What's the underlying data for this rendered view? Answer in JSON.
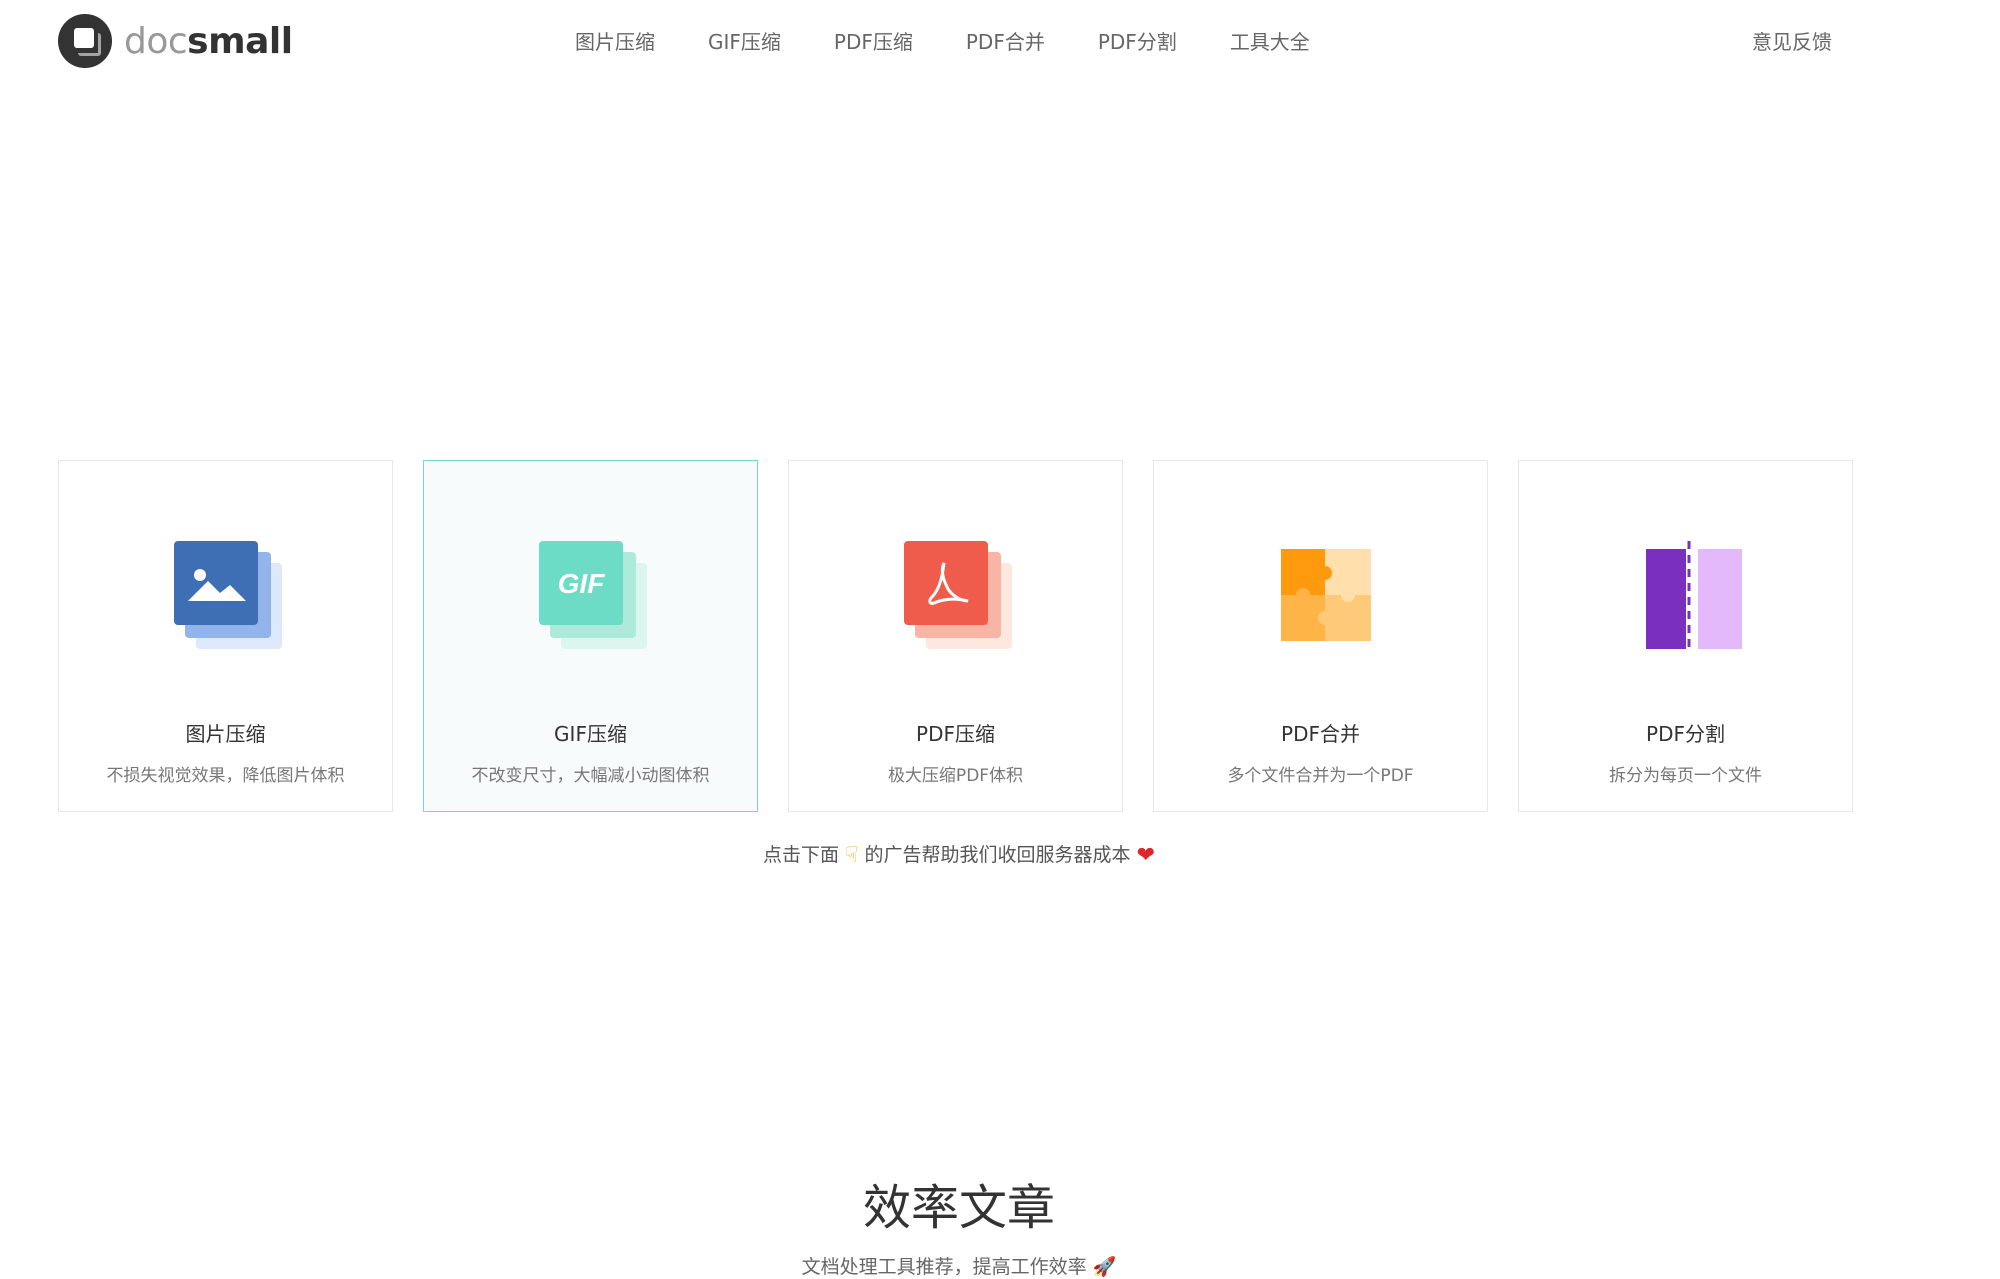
{
  "header": {
    "logo_doc": "doc",
    "logo_small": "small",
    "nav": [
      "图片压缩",
      "GIF压缩",
      "PDF压缩",
      "PDF合并",
      "PDF分割",
      "工具大全"
    ],
    "feedback": "意见反馈"
  },
  "cards": [
    {
      "title": "图片压缩",
      "desc": "不损失视觉效果，降低图片体积",
      "icon": "image-icon",
      "color": "#3e6fb5"
    },
    {
      "title": "GIF压缩",
      "desc": "不改变尺寸，大幅减小动图体积",
      "icon": "gif-icon",
      "color": "#6cdcc6"
    },
    {
      "title": "PDF压缩",
      "desc": "极大压缩PDF体积",
      "icon": "pdf-icon",
      "color": "#ef5c4c"
    },
    {
      "title": "PDF合并",
      "desc": "多个文件合并为一个PDF",
      "icon": "puzzle-icon",
      "color": "#ffa219"
    },
    {
      "title": "PDF分割",
      "desc": "拆分为每页一个文件",
      "icon": "split-icon",
      "color": "#7b2fbe"
    }
  ],
  "gif_label": "GIF",
  "ad_note": {
    "before": "点击下面",
    "after": "的广告帮助我们收回服务器成本"
  },
  "section": {
    "title": "效率文章",
    "subtitle": "文档处理工具推荐，提高工作效率"
  }
}
